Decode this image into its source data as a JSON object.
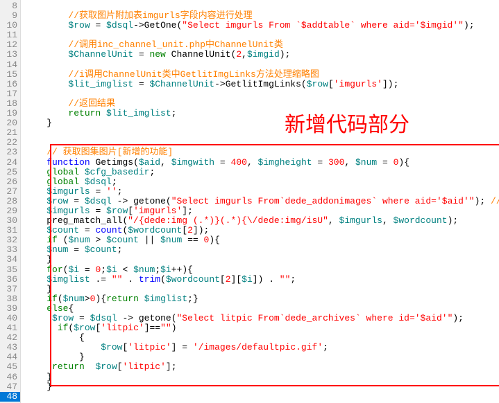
{
  "annotation": "新增代码部分",
  "gutter": {
    "start": 8,
    "end": 48,
    "current": 48
  },
  "code": {
    "l8": "",
    "l9": {
      "cmt": "//获取图片附加表imgurls字段内容进行处理"
    },
    "l10": {
      "v1": "$row",
      "eq": " = ",
      "v2": "$dsql",
      "arrow": "->",
      "fn": "GetOne",
      "open": "(",
      "str": "\"Select imgurls From `$addtable` where aid='$imgid'\"",
      "close": ");"
    },
    "l11": "",
    "l12": {
      "cmt": "//调用inc_channel_unit.php中ChannelUnit类"
    },
    "l13": {
      "v1": "$ChannelUnit",
      "eq": " = ",
      "kw": "new",
      "sp": " ",
      "cls": "ChannelUnit",
      "open": "(",
      "n": "2",
      "comma": ",",
      "v2": "$imgid",
      "close": ");"
    },
    "l14": "",
    "l15": {
      "cmt": "//i调用ChannelUnit类中GetlitImgLinks方法处理缩略图"
    },
    "l16": {
      "v1": "$lit_imglist",
      "eq": " = ",
      "v2": "$ChannelUnit",
      "arrow": "->",
      "fn": "GetlitImgLinks",
      "open": "(",
      "v3": "$row",
      "br1": "[",
      "str": "'imgurls'",
      "br2": "]",
      "close": ");"
    },
    "l17": "",
    "l18": {
      "cmt": "//返回结果"
    },
    "l19": {
      "kw": "return",
      "sp": " ",
      "v": "$lit_imglist",
      "semi": ";"
    },
    "l20": {
      "brace": "}"
    },
    "l21": "",
    "l22": "",
    "l23": {
      "cmt": "// 获取图集图片[新增的功能]"
    },
    "l24": {
      "kw": "function",
      "sp": " ",
      "fn": "Getimgs",
      "open": "(",
      "p1": "$aid",
      "c1": ", ",
      "p2": "$imgwith",
      "eq1": " = ",
      "n1": "400",
      "c2": ", ",
      "p3": "$imgheight",
      "eq2": " = ",
      "n2": "300",
      "c3": ", ",
      "p4": "$num",
      "eq3": " = ",
      "n3": "0",
      "close": "){"
    },
    "l25": {
      "kw": "global",
      "sp": " ",
      "v": "$cfg_basedir",
      "semi": ";"
    },
    "l26": {
      "kw": "global",
      "sp": " ",
      "v": "$dsql",
      "semi": ";"
    },
    "l27": {
      "v": "$imgurls",
      "eq": " = ",
      "str": "''",
      "semi": ";"
    },
    "l28": {
      "v1": "$row",
      "eq": " = ",
      "v2": "$dsql",
      "arrow": " -> ",
      "fn": "getone",
      "open": "(",
      "str": "\"Select imgurls From`dede_addonimages` where aid='$aid'\"",
      "close": "); ",
      "cmt": "//"
    },
    "l29": {
      "v1": "$imgurls",
      "eq": " = ",
      "v2": "$row",
      "br1": "[",
      "str": "'imgurls'",
      "br2": "]",
      "semi": ";"
    },
    "l30": {
      "fn": "preg_match_all",
      "open": "(",
      "str": "\"/{dede:img (.*)}(.*){\\/dede:img/isU\"",
      "c1": ", ",
      "v1": "$imgurls",
      "c2": ", ",
      "v2": "$wordcount",
      "close": ");"
    },
    "l31": {
      "v1": "$count",
      "eq": " = ",
      "fn": "count",
      "open": "(",
      "v2": "$wordcount",
      "br1": "[",
      "n": "2",
      "br2": "]",
      "close": ");"
    },
    "l32": {
      "kw": "if",
      "sp": " ",
      "open": "(",
      "v1": "$num",
      "op1": " > ",
      "v2": "$count",
      "or": " || ",
      "v3": "$num",
      "op2": " == ",
      "n": "0",
      "close": "){"
    },
    "l33": {
      "v1": "$num",
      "eq": " = ",
      "v2": "$count",
      "semi": ";"
    },
    "l34": {
      "brace": "}"
    },
    "l35": {
      "kw": "for",
      "open": "(",
      "v1": "$i",
      "eq1": " = ",
      "n1": "0",
      "semi1": ";",
      "v2": "$i",
      "op": " < ",
      "v3": "$num",
      "semi2": ";",
      "v4": "$i",
      "inc": "++",
      "close": "){"
    },
    "l36": {
      "v1": "$imglist",
      "op": " .= ",
      "s1": "\"\"",
      "d1": " . ",
      "fn": "trim",
      "open": "(",
      "v2": "$wordcount",
      "br1": "[",
      "n1": "2",
      "br2": "][",
      "v3": "$i",
      "br3": "]",
      "close": ")",
      "d2": " . ",
      "s2": "\"\"",
      "semi": ";"
    },
    "l37": {
      "brace": "}"
    },
    "l38": {
      "kw": "if",
      "open": "(",
      "v": "$num",
      "op": ">",
      "n": "0",
      "close": "){",
      "ret": "return",
      "sp": " ",
      "v2": "$imglist",
      "end": ";}"
    },
    "l39": {
      "kw": "else",
      "brace": "{"
    },
    "l40": {
      "v1": "$row",
      "eq": " = ",
      "v2": "$dsql",
      "arrow": " -> ",
      "fn": "getone",
      "open": "(",
      "str": "\"Select litpic From`dede_archives` where id='$aid'\"",
      "close": ");"
    },
    "l41": {
      "kw": "if",
      "open": "(",
      "v": "$row",
      "br1": "[",
      "str": "'litpic'",
      "br2": "]",
      "op": "==",
      "s2": "\"\"",
      "close": ")"
    },
    "l42": {
      "brace": "{"
    },
    "l43": {
      "v": "$row",
      "br1": "[",
      "str": "'litpic'",
      "br2": "]",
      "eq": " = ",
      "str2": "'/images/defaultpic.gif'",
      "semi": ";"
    },
    "l44": {
      "brace": "}"
    },
    "l45": {
      "kw": "return",
      "sp": "  ",
      "v": "$row",
      "br1": "[",
      "str": "'litpic'",
      "br2": "]",
      "semi": ";"
    },
    "l46": {
      "brace": "}"
    },
    "l47": {
      "brace": "}"
    }
  }
}
